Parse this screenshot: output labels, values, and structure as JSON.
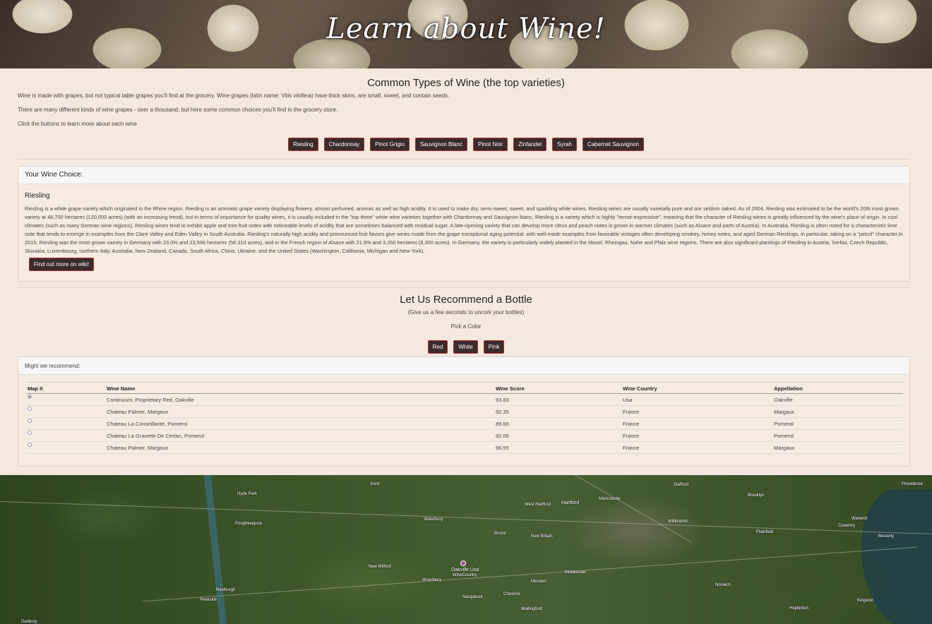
{
  "hero": {
    "title": "Learn about Wine!"
  },
  "types": {
    "title": "Common Types of Wine (the top varieties)",
    "intro1": "Wine is made with grapes, but not typical table grapes you'll find at the grocery. Wine grapes (latin name: Vitis vinifera) have thick skins, are small, sweet, and contain seeds.",
    "intro2": "There are many different kinds of wine grapes - over a thousand, but here some common choices you'll find in the grocery store.",
    "intro3": "Click the buttons to learn more about each wine",
    "buttons": [
      "Riesling",
      "Chardonnay",
      "Pinot Grigio",
      "Sauvignon Blanc",
      "Pinot Noir",
      "Zinfandel",
      "Syrah",
      "Cabernet Sauvignon"
    ]
  },
  "choice": {
    "header": "Your Wine Choice:",
    "name": "Riesling",
    "description": "Riesling is a white grape variety which originated in the Rhine region. Riesling is an aromatic grape variety displaying flowery, almost perfumed, aromas as well as high acidity. It is used to make dry, semi-sweet, sweet, and sparkling white wines. Riesling wines are usually varietally pure and are seldom oaked. As of 2004, Riesling was estimated to be the world's 20th most grown variety at 48,700 hectares (120,000 acres) (with an increasing trend), but in terms of importance for quality wines, it is usually included in the \"top three\" white wine varieties together with Chardonnay and Sauvignon blanc. Riesling is a variety which is highly \"terroir-expressive\", meaning that the character of Riesling wines is greatly influenced by the wine's place of origin. In cool climates (such as many German wine regions), Riesling wines tend to exhibit apple and tree fruit notes with noticeable levels of acidity that are sometimes balanced with residual sugar. A late-ripening variety that can develop more citrus and peach notes is grown in warmer climates (such as Alsace and parts of Austria). In Australia, Riesling is often noted for a characteristic lime note that tends to emerge in examples from the Clare Valley and Eden Valley in South Australia. Riesling's naturally high acidity and pronounced fruit flavors give wines made from the grape exceptional aging potential, with well-made examples from favorable vintages often developing smokey, honey notes, and aged German Rieslings, in particular, taking on a \"petrol\" character.In 2015, Riesling was the most grown variety in Germany with 23.0% and 23,596 hectares (58,310 acres), and in the French region of Alsace with 21.9% and 3,350 hectares (8,300 acres). In Germany, the variety is particularly widely planted in the Mosel, Rheingau, Nahe and Pfalz wine regions. There are also significant plantings of Riesling in Austria, Serbia, Czech Republic, Slovakia, Luxembourg, northern Italy, Australia, New Zealand, Canada, South Africa, China, Ukraine, and the United States (Washington, California, Michigan and New York).",
    "wiki_button": "Find out more on wiki!"
  },
  "recommend": {
    "title": "Let Us Recommend a Bottle",
    "subtitle": "(Give us a few seconds to uncork your bottles)",
    "pick": "Pick a Color",
    "buttons": [
      "Red",
      "White",
      "Pink"
    ],
    "card_header": "Might we recommend:",
    "columns": [
      "Map it",
      "Wine Name",
      "Wine Score",
      "Wine Country",
      "Appellation"
    ],
    "rows": [
      {
        "checked": true,
        "name": "Continuum, Proprietary Red, Oakville",
        "score": "93.83",
        "country": "Usa",
        "appellation": "Oakville"
      },
      {
        "checked": false,
        "name": "Chateau Palmer, Margaux",
        "score": "92.35",
        "country": "France",
        "appellation": "Margaux"
      },
      {
        "checked": false,
        "name": "Chateau La Conseillante, Pomerol",
        "score": "89.66",
        "country": "France",
        "appellation": "Pomerol"
      },
      {
        "checked": false,
        "name": "Chateau La Gravette De Certan, Pomerol",
        "score": "92.06",
        "country": "France",
        "appellation": "Pomerol"
      },
      {
        "checked": false,
        "name": "Chateau Palmer, Margaux",
        "score": "96.55",
        "country": "France",
        "appellation": "Margaux"
      }
    ]
  },
  "map": {
    "pin_label": "Oakville Usa",
    "pin_sublabel": "WineCountry",
    "labels": [
      "Hartford",
      "Waterbury",
      "New Milford",
      "Meriden",
      "Middletown",
      "Manchester",
      "Bristol",
      "New Britain",
      "Wallingford",
      "Cheshire",
      "Naugatuck",
      "Danbury",
      "Newburgh",
      "Poughkeepsie",
      "Hyde Park",
      "Willimantic",
      "Norwich",
      "Stafford",
      "Brooklyn",
      "Plainfield",
      "Kingston",
      "Providence",
      "Warwick",
      "Coventry",
      "Hopkinton",
      "Westerly",
      "Woodbury",
      "West Hartford",
      "Peekskill",
      "Kent"
    ]
  }
}
